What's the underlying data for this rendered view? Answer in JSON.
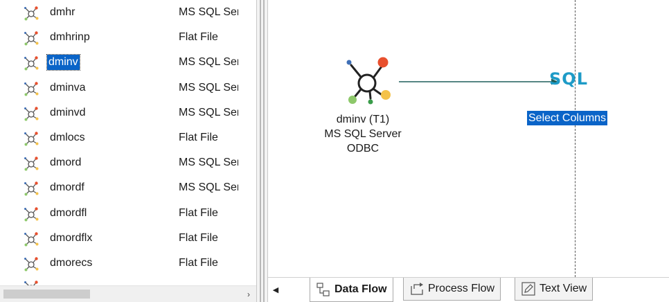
{
  "list": {
    "rows": [
      {
        "name": "dmhr",
        "type": "MS SQL Server"
      },
      {
        "name": "dmhrinp",
        "type": "Flat File"
      },
      {
        "name": "dminv",
        "type": "MS SQL Server",
        "selected": true
      },
      {
        "name": "dminva",
        "type": "MS SQL Server"
      },
      {
        "name": "dminvd",
        "type": "MS SQL Server"
      },
      {
        "name": "dmlocs",
        "type": "Flat File"
      },
      {
        "name": "dmord",
        "type": "MS SQL Server"
      },
      {
        "name": "dmordf",
        "type": "MS SQL Server"
      },
      {
        "name": "dmordfl",
        "type": "Flat File"
      },
      {
        "name": "dmordflx",
        "type": "Flat File"
      },
      {
        "name": "dmorecs",
        "type": "Flat File"
      }
    ],
    "row_icon": "data-source-icon"
  },
  "canvas": {
    "source_node": {
      "line1": "dminv (T1)",
      "line2": "MS SQL Server",
      "line3": "ODBC",
      "icon": "data-source-icon"
    },
    "sql_node": {
      "icon_text": "SQL",
      "label": "Select Columns"
    }
  },
  "tabs": {
    "items": [
      {
        "label": "Data Flow",
        "icon": "data-flow-icon",
        "active": true
      },
      {
        "label": "Process Flow",
        "icon": "process-flow-icon",
        "active": false
      },
      {
        "label": "Text View",
        "icon": "pencil-icon",
        "active": false
      }
    ]
  },
  "colors": {
    "selection": "#0a64c8",
    "sql_accent": "#1e9bc7",
    "arrow": "#1f5f5b"
  }
}
